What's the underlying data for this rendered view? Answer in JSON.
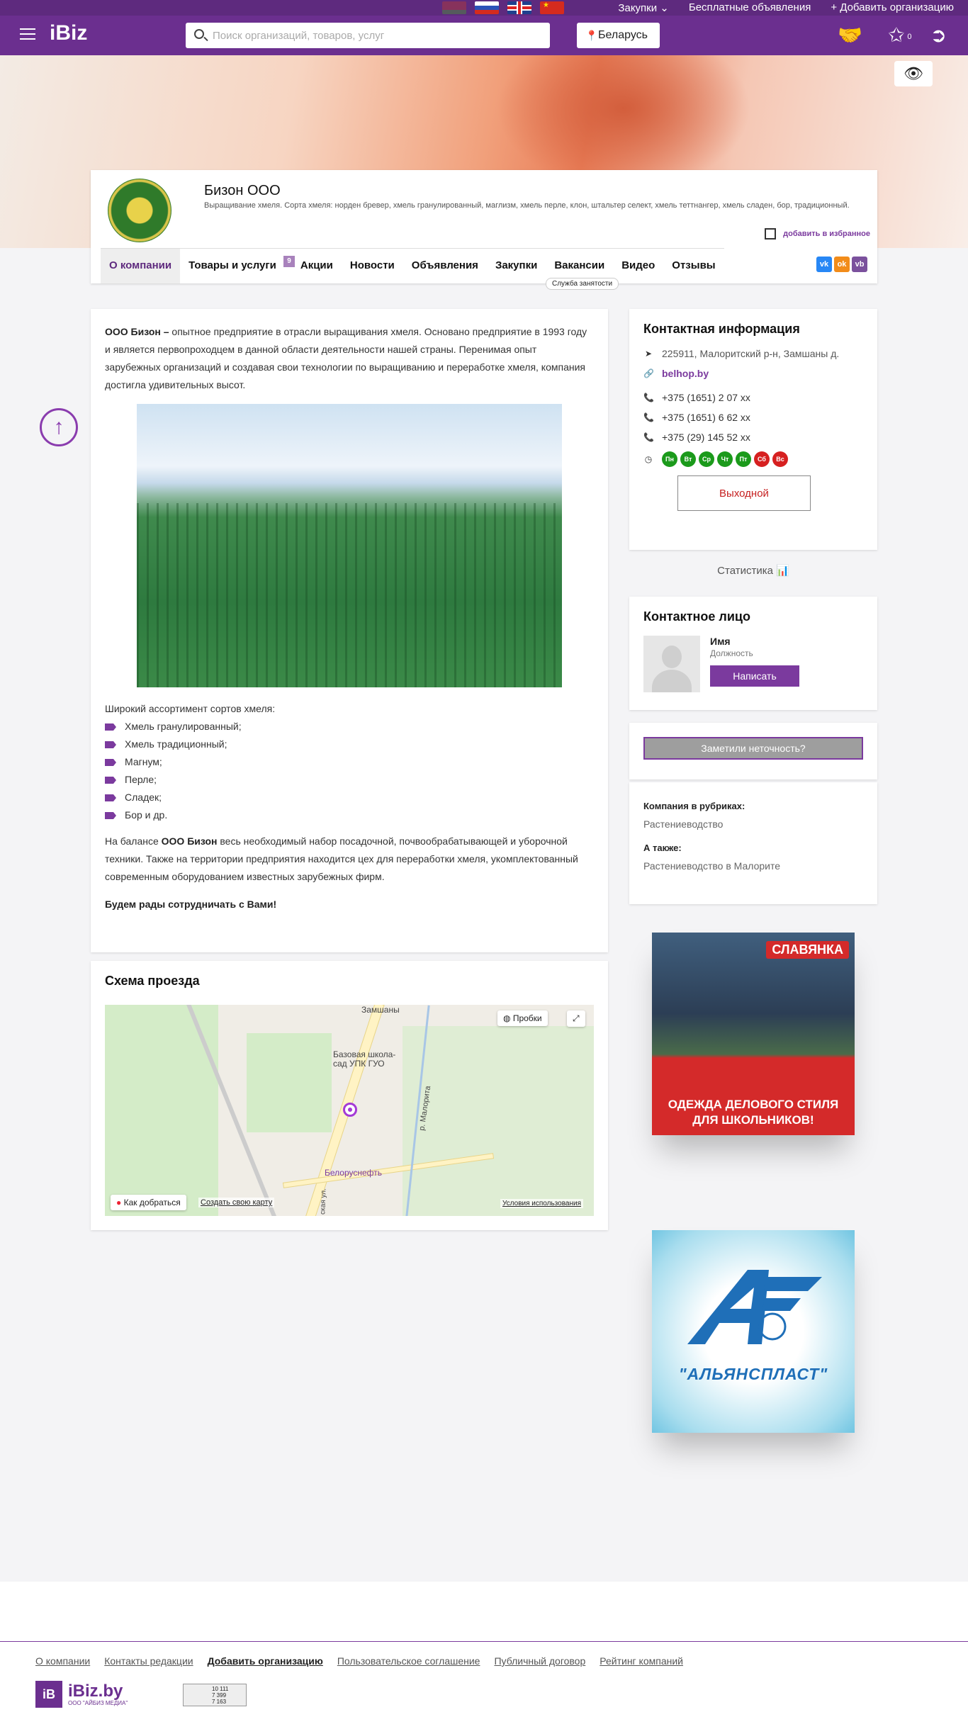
{
  "header": {
    "logo": "iBiz",
    "search_placeholder": "Поиск организаций, товаров, услуг",
    "region": "Беларусь",
    "top_links": [
      "Закупки ⌄",
      "Бесплатные объявления",
      "+ Добавить организацию"
    ],
    "fav_count": "0"
  },
  "company": {
    "name": "Бизон ООО",
    "description": "Выращивание хмеля. Сорта хмеля: норден бревер, хмель гранулированный, маглизм, хмель перле, клон, штальтер селект, хмель теттнангер, хмель сладен, бор, традиционный.",
    "favorite_label": "добавить в избранное",
    "tabs": [
      {
        "label": "О компании"
      },
      {
        "label": "Товары и услуги",
        "count": "9"
      },
      {
        "label": "Акции"
      },
      {
        "label": "Новости"
      },
      {
        "label": "Объявления"
      },
      {
        "label": "Закупки"
      },
      {
        "label": "Вакансии"
      },
      {
        "label": "Видео"
      },
      {
        "label": "Отзывы"
      }
    ],
    "tooltip": "Служба занятости",
    "social": [
      "vk",
      "ok",
      "vb"
    ]
  },
  "about": {
    "intro_bold": "ООО Бизон –",
    "intro_text": " опытное предприятие в отрасли выращивания хмеля. Основано предприятие в 1993 году и является первопроходцем в данной области деятельности нашей страны. Перенимая опыт зарубежных организаций и создавая свои технологии по выращиванию и переработке хмеля, компания достигла удивительных высот.",
    "list_title": "Широкий ассортимент сортов хмеля:",
    "list": [
      "Хмель гранулированный;",
      "Хмель традиционный;",
      "Магнум;",
      "Перле;",
      "Сладек;",
      "Бор и др."
    ],
    "p2_start": "На балансе ",
    "p2_bold": "ООО Бизон",
    "p2_text": " весь необходимый набор посадочной, почвообрабатывающей и уборочной техники. Также на территории предприятия находится цех для переработки хмеля, укомплектованный современным оборудованием известных зарубежных фирм.",
    "closing": "Будем рады сотрудничать с Вами!"
  },
  "map": {
    "title": "Схема проезда",
    "traffic_btn": "Пробки",
    "labels": [
      "Замшаны",
      "Базовая школа-сад УПК ГУО",
      "Белоруснефть",
      "р. Малорита",
      "ская ул."
    ],
    "route_btn": "Как добраться",
    "create_link": "Создать свою карту",
    "terms_link": "Условия использования"
  },
  "contacts": {
    "title": "Контактная информация",
    "address": "225911, Малоритский р-н, Замшаны д.",
    "site": "belhop.by",
    "phones": [
      "+375 (1651) 2 07 xx",
      "+375 (1651) 6 62 xx",
      "+375 (29) 145 52 xx"
    ],
    "days": [
      {
        "d": "Пн",
        "on": true
      },
      {
        "d": "Вт",
        "on": true
      },
      {
        "d": "Ср",
        "on": true
      },
      {
        "d": "Чт",
        "on": true
      },
      {
        "d": "Пт",
        "on": true
      },
      {
        "d": "Сб",
        "on": false
      },
      {
        "d": "Вс",
        "on": false
      }
    ],
    "status": "Выходной"
  },
  "stats_label": "Статистика",
  "person": {
    "title": "Контактное лицо",
    "name": "Имя",
    "position": "Должность",
    "write_btn": "Написать"
  },
  "error_btn": "Заметили неточность?",
  "rubrics": {
    "title": "Компания в рубриках:",
    "item": "Растениеводство",
    "also_title": "А также:",
    "also_item": "Растениеводство в Малорите"
  },
  "ads": {
    "ad1_brand": "СЛАВЯНКА",
    "ad1_slogan": "ОДЕЖДА ДЕЛОВОГО СТИЛЯ ДЛЯ ШКОЛЬНИКОВ!",
    "ad2_name": "\"АЛЬЯНСПЛАСТ\""
  },
  "footer": {
    "links": [
      "О компании",
      "Контакты редакции",
      "Добавить организацию",
      "Пользовательское соглашение",
      "Публичный договор",
      "Рейтинг компаний"
    ],
    "logo_sq": "iB",
    "logo_text": "iBiz.by",
    "logo_sub": "ООО \"АЙБИЗ МЕДИА\"",
    "counter": [
      "10 111",
      "7 399",
      "7 163"
    ]
  },
  "colors": {
    "brand": "#6b2f8f",
    "accent": "#7b3a9e",
    "open": "#1b9a1b",
    "closed": "#d62020"
  }
}
